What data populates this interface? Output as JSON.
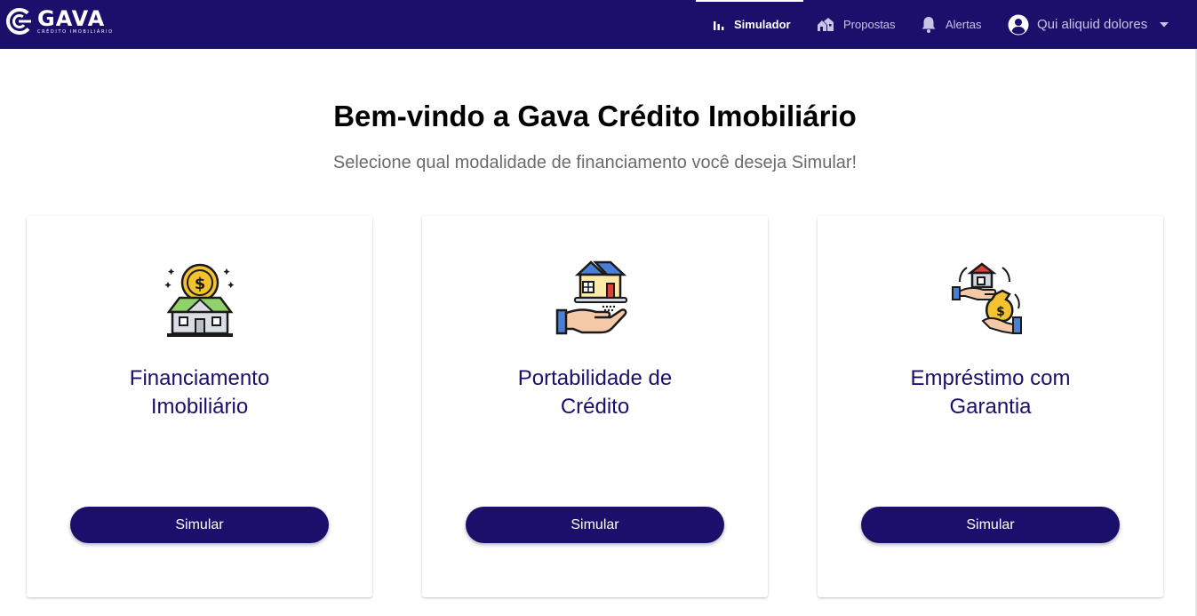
{
  "brand": {
    "name": "GAVA",
    "tagline": "CRÉDITO IMOBILIÁRIO"
  },
  "nav": {
    "simulador": "Simulador",
    "propostas": "Propostas",
    "alertas": "Alertas",
    "user_name": "Qui aliquid dolores"
  },
  "colors": {
    "primary": "#1a0f6b",
    "subtitle": "#6b6b6b"
  },
  "main": {
    "title": "Bem-vindo a Gava Crédito Imobiliário",
    "subtitle": "Selecione qual modalidade de financiamento você deseja Simular!"
  },
  "cards": [
    {
      "title_line1": "Financiamento",
      "title_line2": "Imobiliário",
      "button": "Simular",
      "icon": "house-coin-icon"
    },
    {
      "title_line1": "Portabilidade de",
      "title_line2": "Crédito",
      "button": "Simular",
      "icon": "hand-house-icon"
    },
    {
      "title_line1": "Empréstimo com",
      "title_line2": "Garantia",
      "button": "Simular",
      "icon": "house-money-exchange-icon"
    }
  ]
}
